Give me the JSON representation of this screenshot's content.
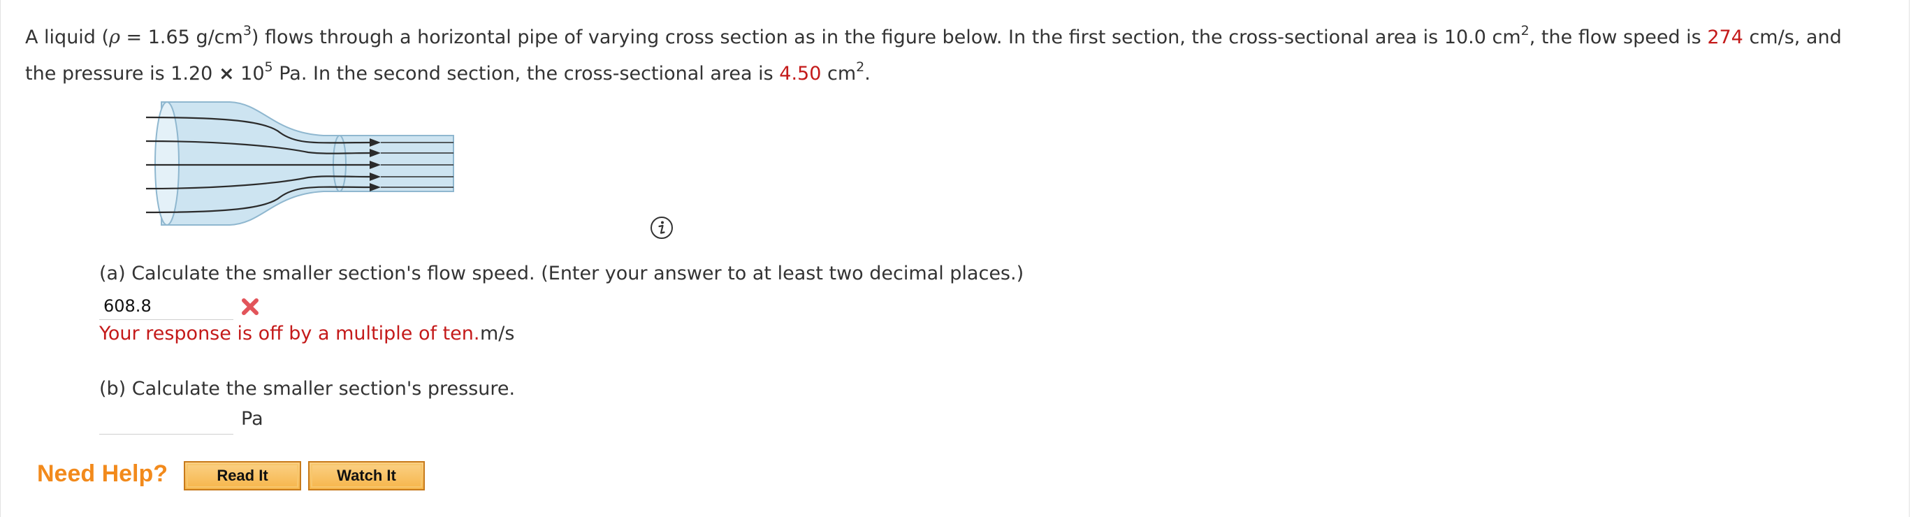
{
  "problem": {
    "intro": "A liquid (",
    "rho_symbol": "ρ",
    "density_text": " = 1.65 g/cm",
    "density_exp": "3",
    "after_density": ") flows through a horizontal pipe of varying cross section as in the figure below. In the first section, the cross-sectional area is 10.0 cm",
    "area1_exp": "2",
    "after_area1": ", the flow speed is ",
    "speed_value": "274",
    "speed_unit_text": " cm/s, and the pressure is 1.20 ",
    "times_symbol": "×",
    "ten_text": " 10",
    "pressure_exp": "5",
    "after_pressure": " Pa. In the second section, the cross-sectional area is ",
    "area2_value": "4.50",
    "area2_unit": " cm",
    "area2_exp": "2",
    "end_period": "."
  },
  "part_a": {
    "question": "(a) Calculate the smaller section's flow speed. (Enter your answer to at least two decimal places.)",
    "answer_value": "608.8",
    "feedback": "Your response is off by a multiple of ten.",
    "unit": "m/s"
  },
  "part_b": {
    "question": "(b) Calculate the smaller section's pressure.",
    "answer_value": "",
    "unit": "Pa"
  },
  "help": {
    "label": "Need Help?",
    "read_it": "Read It",
    "watch_it": "Watch It"
  },
  "icons": {
    "info": "info-circle-icon",
    "incorrect": "x-mark-icon"
  },
  "colors": {
    "highlight_red": "#c41a1a",
    "need_help_orange": "#f28a1c",
    "button_fill": "#f6b54a",
    "pipe_fill": "#cde4f1"
  }
}
